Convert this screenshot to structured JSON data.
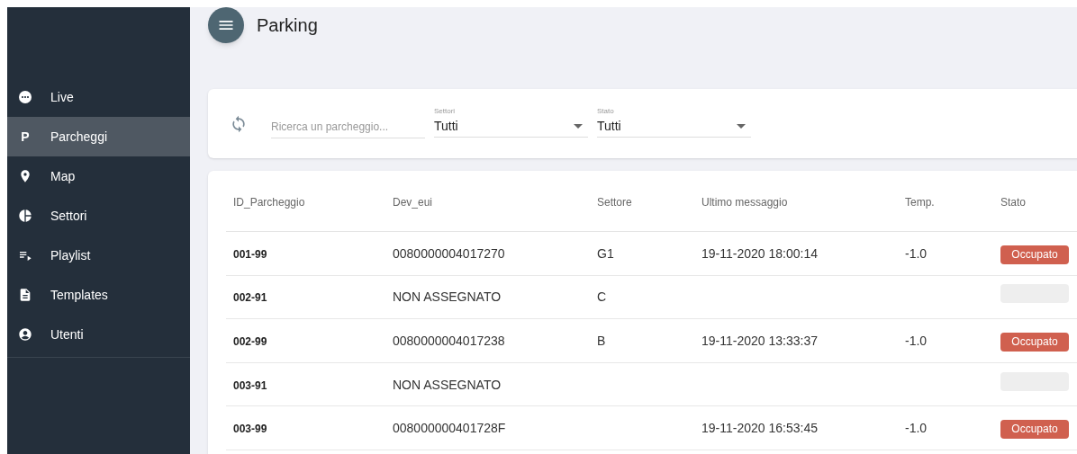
{
  "sidebar": {
    "items": [
      {
        "label": "Live",
        "selected": false
      },
      {
        "label": "Parcheggi",
        "selected": true
      },
      {
        "label": "Map",
        "selected": false
      },
      {
        "label": "Settori",
        "selected": false
      },
      {
        "label": "Playlist",
        "selected": false
      },
      {
        "label": "Templates",
        "selected": false
      },
      {
        "label": "Utenti",
        "selected": false
      }
    ]
  },
  "p_letter": "P",
  "header": {
    "title": "Parking"
  },
  "filters": {
    "search": {
      "placeholder": "Ricerca un parcheggio..."
    },
    "selects": [
      {
        "label": "Settori",
        "value": "Tutti"
      },
      {
        "label": "Stato",
        "value": "Tutti"
      }
    ]
  },
  "table": {
    "columns": [
      "ID_Parcheggio",
      "Dev_eui",
      "Settore",
      "Ultimo messaggio",
      "Temp.",
      "Stato"
    ],
    "rows": [
      {
        "id": "001-99",
        "dev_eui": "0080000004017270",
        "settore": "G1",
        "ultimo": "19-11-2020 18:00:14",
        "temp": "-1.0",
        "stato": {
          "kind": "occupied",
          "label": "Occupato"
        }
      },
      {
        "id": "002-91",
        "dev_eui": "NON ASSEGNATO",
        "settore": "C",
        "stato": {
          "kind": "empty"
        }
      },
      {
        "id": "002-99",
        "dev_eui": "0080000004017238",
        "settore": "B",
        "ultimo": "19-11-2020 13:33:37",
        "temp": "-1.0",
        "stato": {
          "kind": "occupied",
          "label": "Occupato"
        }
      },
      {
        "id": "003-91",
        "dev_eui": "NON ASSEGNATO",
        "stato": {
          "kind": "empty"
        }
      },
      {
        "id": "003-99",
        "dev_eui": "008000000401728F",
        "ultimo": "19-11-2020 16:53:45",
        "temp": "-1.0",
        "stato": {
          "kind": "occupied",
          "label": "Occupato"
        }
      }
    ]
  }
}
